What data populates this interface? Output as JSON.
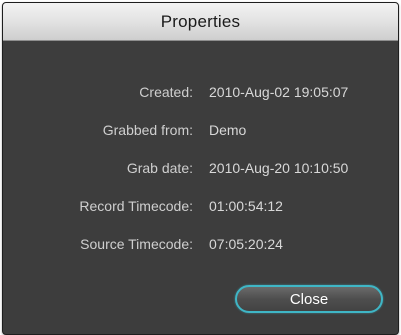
{
  "window": {
    "title": "Properties"
  },
  "properties": [
    {
      "label": "Created:",
      "value": "2010-Aug-02 19:05:07"
    },
    {
      "label": "Grabbed from:",
      "value": "Demo"
    },
    {
      "label": "Grab date:",
      "value": "2010-Aug-20 10:10:50"
    },
    {
      "label": "Record Timecode:",
      "value": "01:00:54:12"
    },
    {
      "label": "Source Timecode:",
      "value": "07:05:20:24"
    }
  ],
  "buttons": {
    "close_label": "Close"
  },
  "colors": {
    "panel_background": "#3d3d3d",
    "button_accent": "#3fb6c6"
  }
}
